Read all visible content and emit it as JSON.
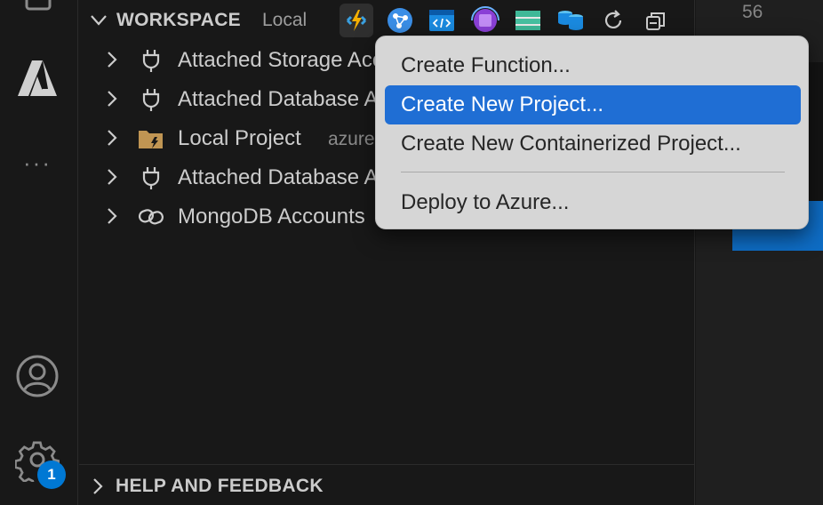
{
  "activity_bar": {
    "icons": [
      "explorer-icon",
      "azure-icon",
      "more-icon",
      "account-icon",
      "settings-gear-icon"
    ],
    "more_label": "···",
    "settings_badge": "1"
  },
  "workspace": {
    "title": "WORKSPACE",
    "subtitle": "Local",
    "toolbar_icons": [
      "azure-functions-icon",
      "app-service-icon",
      "static-web-apps-icon",
      "container-apps-icon",
      "storage-icon",
      "database-icon",
      "refresh-icon",
      "collapse-all-icon"
    ],
    "items": [
      {
        "label": "Attached Storage Accounts",
        "icon": "plug-icon",
        "description": ""
      },
      {
        "label": "Attached Database Accounts",
        "icon": "plug-icon",
        "description": ""
      },
      {
        "label": "Local Project",
        "icon": "project-folder-icon",
        "description": "azure"
      },
      {
        "label": "Attached Database Accounts",
        "icon": "plug-icon",
        "description": ""
      },
      {
        "label": "MongoDB Accounts",
        "icon": "link-icon",
        "description": ""
      }
    ]
  },
  "help": {
    "title": "HELP AND FEEDBACK"
  },
  "editor": {
    "line_number": "56"
  },
  "context_menu": {
    "items": [
      {
        "label": "Create Function...",
        "selected": false
      },
      {
        "label": "Create New Project...",
        "selected": true
      },
      {
        "label": "Create New Containerized Project...",
        "selected": false
      },
      {
        "label": "Deploy to Azure...",
        "selected": false
      }
    ]
  },
  "colors": {
    "background": "#181818",
    "menu_background": "#d6d6d6",
    "menu_selection": "#1f6ed4",
    "badge": "#0078d4",
    "folder_icon": "#c09553"
  }
}
